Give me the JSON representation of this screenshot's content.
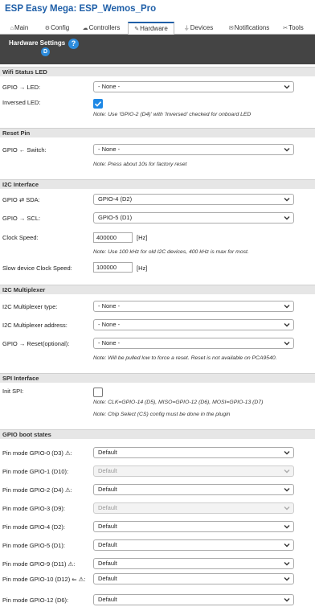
{
  "app_title": "ESP Easy Mega: ESP_Wemos_Pro",
  "tabs": [
    {
      "label": "Main",
      "icon": "home-icon"
    },
    {
      "label": "Config",
      "icon": "gear-icon"
    },
    {
      "label": "Controllers",
      "icon": "cloud-icon"
    },
    {
      "label": "Hardware",
      "icon": "pin-icon"
    },
    {
      "label": "Devices",
      "icon": "plug-icon"
    },
    {
      "label": "Notifications",
      "icon": "mail-icon"
    },
    {
      "label": "Tools",
      "icon": "wrench-icon"
    }
  ],
  "header": {
    "title": "Hardware Settings",
    "help": "?",
    "badge": "D"
  },
  "wifi": {
    "section": "Wifi Status LED",
    "led_label": "GPIO → LED:",
    "led_value": "- None -",
    "inverse_label": "Inversed LED:",
    "inverse_checked": true,
    "note": "Note: Use 'GPIO-2 (D4)' with 'Inversed' checked for onboard LED"
  },
  "reset": {
    "section": "Reset Pin",
    "switch_label": "GPIO ← Switch:",
    "switch_value": "- None -",
    "note": "Note: Press about 10s for factory reset"
  },
  "i2c": {
    "section": "I2C Interface",
    "sda_label": "GPIO ⇄ SDA:",
    "sda_value": "GPIO-4 (D2)",
    "scl_label": "GPIO → SCL:",
    "scl_value": "GPIO-5 (D1)",
    "clock_label": "Clock Speed:",
    "clock_value": "400000",
    "clock_unit": "[Hz]",
    "note": "Note: Use 100 kHz for old I2C devices, 400 kHz is max for most.",
    "slow_label": "Slow device Clock Speed:",
    "slow_value": "100000",
    "slow_unit": "[Hz]"
  },
  "mux": {
    "section": "I2C Multiplexer",
    "type_label": "I2C Multiplexer type:",
    "type_value": "- None -",
    "addr_label": "I2C Multiplexer address:",
    "addr_value": "- None -",
    "reset_label": "GPIO → Reset(optional):",
    "reset_value": "- None -",
    "note": "Note: Will be pulled low to force a reset. Reset is not available on PCA9540."
  },
  "spi": {
    "section": "SPI Interface",
    "init_label": "Init SPI:",
    "init_checked": false,
    "note1": "Note: CLK=GPIO-14 (D5), MISO=GPIO-12 (D6), MOSI=GPIO-13 (D7)",
    "note2": "Note: Chip Select (CS) config must be done in the plugin"
  },
  "boot": {
    "section": "GPIO boot states",
    "rows": [
      {
        "label": "Pin mode GPIO-0 (D3) ⚠:",
        "value": "Default",
        "disabled": false
      },
      {
        "label": "Pin mode GPIO-1 (D10):",
        "value": "Default",
        "disabled": true
      },
      {
        "label": "Pin mode GPIO-2 (D4) ⚠:",
        "value": "Default",
        "disabled": false
      },
      {
        "label": "Pin mode GPIO-3 (D9):",
        "value": "Default",
        "disabled": true
      },
      {
        "label": "Pin mode GPIO-4 (D2):",
        "value": "Default",
        "disabled": false
      },
      {
        "label": "Pin mode GPIO-5 (D1):",
        "value": "Default",
        "disabled": false
      },
      {
        "label": "Pin mode GPIO-9 (D11) ⚠:",
        "value": "Default",
        "disabled": false
      },
      {
        "label": "Pin mode GPIO-10 (D12) ⇐ ⚠:",
        "value": "Default",
        "disabled": false
      },
      {
        "label": "Pin mode GPIO-12 (D6):",
        "value": "Default",
        "disabled": false
      }
    ]
  }
}
